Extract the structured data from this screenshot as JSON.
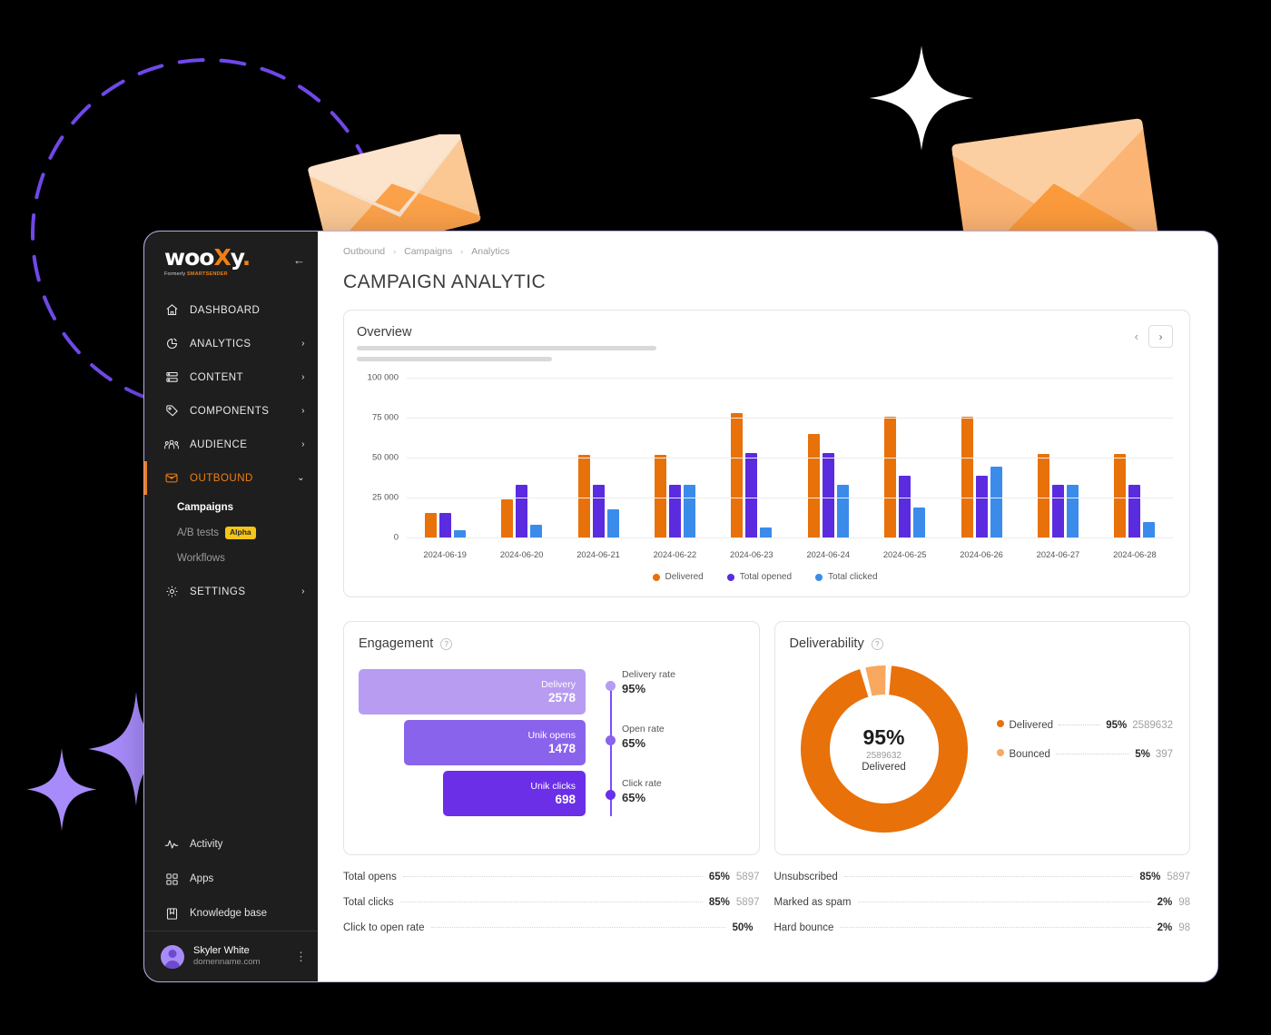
{
  "sidebar": {
    "logo": {
      "text_a": "woo",
      "text_x": "X",
      "text_b": "y",
      "dot": ".",
      "sub_prefix": "Formerly ",
      "sub_brand": "SMARTSENDER",
      "collapse_icon": "collapse-arrow-icon"
    },
    "items": [
      {
        "label": "DASHBOARD",
        "icon": "home-icon",
        "chevron": "",
        "active": false
      },
      {
        "label": "ANALYTICS",
        "icon": "pie-chart-icon",
        "chevron": "›",
        "active": false
      },
      {
        "label": "CONTENT",
        "icon": "list-icon",
        "chevron": "›",
        "active": false
      },
      {
        "label": "COMPONENTS",
        "icon": "tag-icon",
        "chevron": "›",
        "active": false
      },
      {
        "label": "AUDIENCE",
        "icon": "people-icon",
        "chevron": "›",
        "active": false
      },
      {
        "label": "OUTBOUND",
        "icon": "envelope-icon",
        "chevron": "⌄",
        "active": true
      }
    ],
    "subitems": [
      {
        "label": "Campaigns",
        "badge": "",
        "current": true
      },
      {
        "label": "A/B tests",
        "badge": "Alpha",
        "current": false
      },
      {
        "label": "Workflows",
        "badge": "",
        "current": false
      }
    ],
    "settings": {
      "label": "SETTINGS",
      "icon": "gear-icon",
      "chevron": "›"
    },
    "bottom_items": [
      {
        "label": "Activity",
        "icon": "activity-pulse-icon"
      },
      {
        "label": "Apps",
        "icon": "apps-grid-icon"
      },
      {
        "label": "Knowledge base",
        "icon": "book-icon"
      }
    ],
    "user": {
      "name": "Skyler White",
      "domain": "domenname.com",
      "menu_icon": "kebab-menu-icon",
      "avatar": "user-avatar"
    }
  },
  "header": {
    "breadcrumb": [
      "Outbound",
      "Campaigns",
      "Analytics"
    ],
    "separator": "›",
    "title": "CAMPAIGN ANALYTIC"
  },
  "overview": {
    "title": "Overview",
    "prev_icon": "chevron-left-icon",
    "next_icon": "chevron-right-icon"
  },
  "chart_data": {
    "type": "bar",
    "title": "Overview",
    "xlabel": "",
    "ylabel": "",
    "ylim": [
      0,
      100000
    ],
    "yticks": [
      "0",
      "25 000",
      "50 000",
      "75 000",
      "100 000"
    ],
    "ytick_values": [
      0,
      25000,
      50000,
      75000,
      100000
    ],
    "grid": true,
    "legend_position": "bottom",
    "categories": [
      "2024-06-19",
      "2024-06-20",
      "2024-06-21",
      "2024-06-22",
      "2024-06-23",
      "2024-06-24",
      "2024-06-25",
      "2024-06-26",
      "2024-06-27",
      "2024-06-28"
    ],
    "series": [
      {
        "name": "Delivered",
        "color": "#E8710A",
        "values": [
          15500,
          24000,
          51500,
          51500,
          78000,
          65000,
          75500,
          75500,
          52000,
          52000
        ]
      },
      {
        "name": "Total opened",
        "color": "#5B2BE0",
        "values": [
          15500,
          33000,
          33000,
          33000,
          53000,
          53000,
          38500,
          38500,
          33000,
          33000
        ]
      },
      {
        "name": "Total clicked",
        "color": "#3B8BEB",
        "values": [
          4800,
          8000,
          17500,
          33000,
          6200,
          33000,
          18500,
          44500,
          33000,
          9500
        ]
      }
    ]
  },
  "engagement": {
    "title": "Engagement",
    "help_icon": "help-circle-icon",
    "bars": [
      {
        "label": "Delivery",
        "value": "2578",
        "color": "#B79CF2",
        "width_pct": 100
      },
      {
        "label": "Unik opens",
        "value": "1478",
        "color": "#8A63EC",
        "width_pct": 80
      },
      {
        "label": "Unik clicks",
        "value": "698",
        "color": "#6B2FE8",
        "width_pct": 63
      }
    ],
    "rates": [
      {
        "label": "Delivery rate",
        "value": "95%",
        "color": "#B79CF2"
      },
      {
        "label": "Open rate",
        "value": "65%",
        "color": "#8A63EC"
      },
      {
        "label": "Click rate",
        "value": "65%",
        "color": "#6B2FE8"
      }
    ]
  },
  "deliverability": {
    "title": "Deliverability",
    "help_icon": "help-circle-icon",
    "center_pct": "95%",
    "center_count": "2589632",
    "center_label": "Delivered",
    "donut": {
      "type": "pie",
      "slices": [
        {
          "name": "Delivered",
          "pct": 95,
          "value": 2589632,
          "color": "#E8710A"
        },
        {
          "name": "Bounced",
          "pct": 5,
          "value": 397,
          "color": "#F9A860"
        }
      ]
    },
    "legend": [
      {
        "name": "Delivered",
        "pct": "95%",
        "count": "2589632",
        "color": "#E8710A"
      },
      {
        "name": "Bounced",
        "pct": "5%",
        "count": "397",
        "color": "#F9A860"
      }
    ]
  },
  "stats": {
    "left": [
      {
        "name": "Total opens",
        "pct": "65%",
        "count": "5897"
      },
      {
        "name": "Total clicks",
        "pct": "85%",
        "count": "5897"
      },
      {
        "name": "Click to open rate",
        "pct": "50%",
        "count": ""
      }
    ],
    "right": [
      {
        "name": "Unsubscribed",
        "pct": "85%",
        "count": "5897"
      },
      {
        "name": "Marked as spam",
        "pct": "2%",
        "count": "98"
      },
      {
        "name": "Hard bounce",
        "pct": "2%",
        "count": "98"
      }
    ]
  },
  "decoration": {
    "dashed_circle": "dashed-circle-decoration",
    "white_sparkle": "sparkle-icon",
    "purple_sparkle_large": "sparkle-icon",
    "purple_sparkle_small": "sparkle-icon",
    "envelope_small": "envelope-illustration",
    "envelope_large": "envelope-illustration",
    "colors": {
      "accent_orange": "#F07F13",
      "accent_purple": "#7C4DFF",
      "sidebar_bg": "#1e1e1e"
    }
  }
}
